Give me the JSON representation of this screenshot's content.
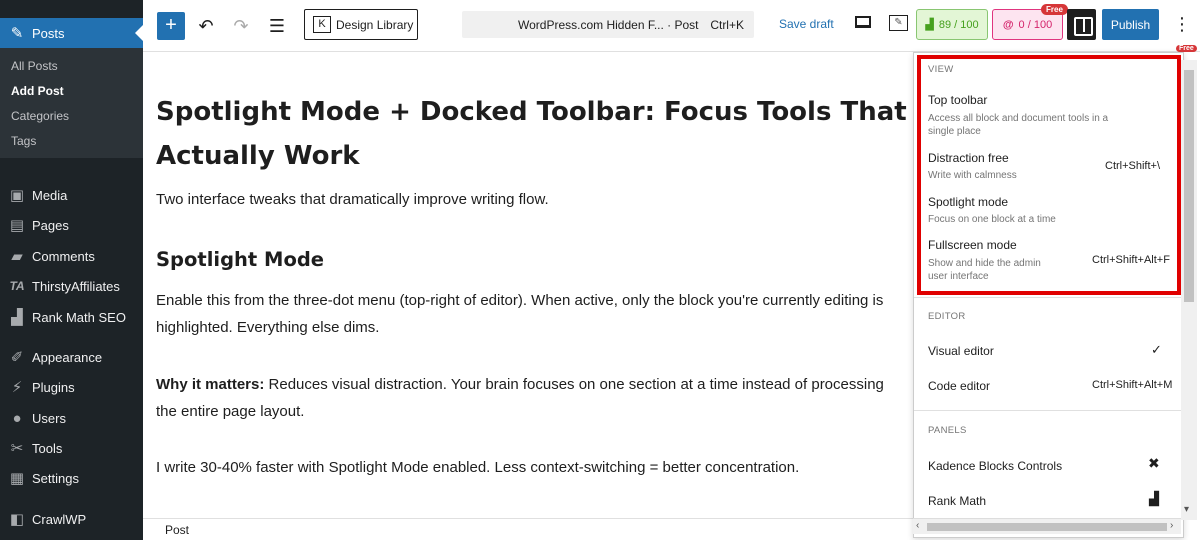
{
  "admin_menu": {
    "posts": "Posts",
    "submenu": [
      "All Posts",
      "Add Post",
      "Categories",
      "Tags"
    ],
    "items": [
      {
        "label": "Media",
        "icon": "media-icon"
      },
      {
        "label": "Pages",
        "icon": "pages-icon"
      },
      {
        "label": "Comments",
        "icon": "comments-icon"
      },
      {
        "label": "ThirstyAffiliates",
        "icon": "thirstyaffiliates-icon"
      },
      {
        "label": "Rank Math SEO",
        "icon": "rank-math-icon"
      },
      {
        "label": "Appearance",
        "icon": "appearance-icon"
      },
      {
        "label": "Plugins",
        "icon": "plugins-icon"
      },
      {
        "label": "Users",
        "icon": "users-icon"
      },
      {
        "label": "Tools",
        "icon": "tools-icon"
      },
      {
        "label": "Settings",
        "icon": "settings-icon"
      },
      {
        "label": "CrawlWP",
        "icon": "crawlwp-icon"
      }
    ],
    "ta_glyph": "TA"
  },
  "header": {
    "add": "+",
    "undo": "↶",
    "redo": "↷",
    "outline": "☰",
    "design_library": "Design Library",
    "dl_glyph": "K",
    "doc_title": "WordPress.com Hidden F... · Post",
    "doc_shortcut": "Ctrl+K",
    "save_draft": "Save draft",
    "rank_math_score": "89 / 100",
    "content_ai": "0 / 100",
    "free_badge": "Free",
    "publish": "Publish",
    "more": "⋮"
  },
  "post": {
    "title": "Spotlight Mode + Docked Toolbar: Focus Tools That Actually Work",
    "intro": "Two interface tweaks that dramatically improve writing flow.",
    "heading": "Spotlight Mode",
    "p1": "Enable this from the three-dot menu (top-right of editor). When active, only the block you're currently editing is highlighted. Everything else dims.",
    "p2_strong": "Why it matters:",
    "p2": " Reduces visual distraction. Your brain focuses on one section at a time instead of processing the entire page layout.",
    "p3": "I write 30-40% faster with Spotlight Mode enabled. Less context-switching = better concentration."
  },
  "footer": {
    "breadcrumb": "Post"
  },
  "menu": {
    "view_label": "VIEW",
    "top_toolbar": "Top toolbar",
    "top_toolbar_desc": "Access all block and document tools in a single place",
    "distraction_free": "Distraction free",
    "distraction_free_desc": "Write with calmness",
    "distraction_free_sc": "Ctrl+Shift+\\",
    "spotlight": "Spotlight mode",
    "spotlight_desc": "Focus on one block at a time",
    "fullscreen": "Fullscreen mode",
    "fullscreen_desc": "Show and hide the admin user interface",
    "fullscreen_sc": "Ctrl+Shift+Alt+F",
    "editor_label": "EDITOR",
    "visual_editor": "Visual editor",
    "visual_check": "✓",
    "code_editor": "Code editor",
    "code_sc": "Ctrl+Shift+Alt+M",
    "panels_label": "PANELS",
    "kadence": "Kadence Blocks Controls",
    "rank_math": "Rank Math",
    "free_badge": "Free"
  },
  "colors": {
    "highlight": "#e00000",
    "accent": "#2271b1",
    "admin_bg": "#1d2327"
  }
}
